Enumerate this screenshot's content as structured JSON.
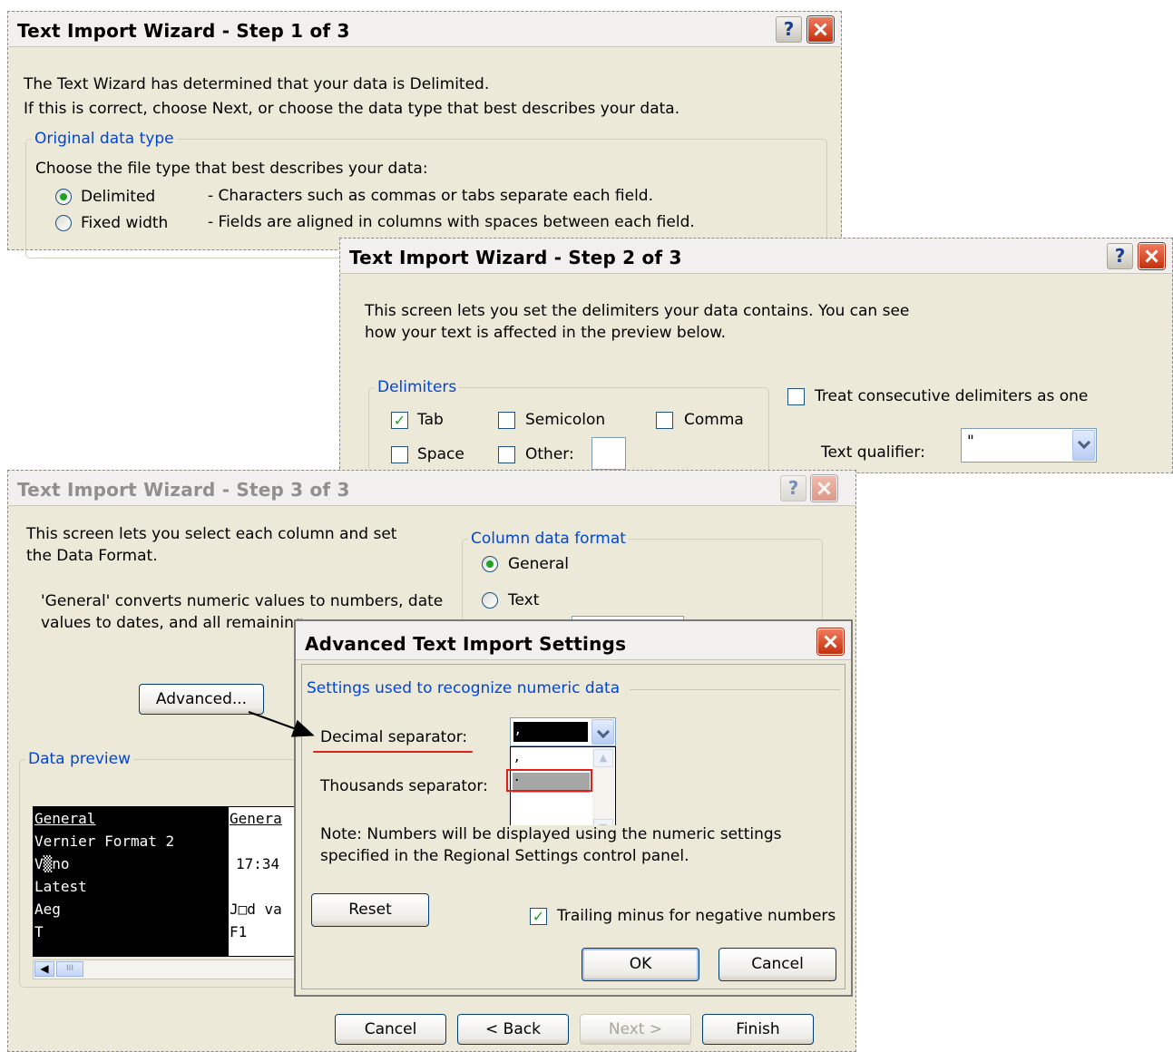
{
  "step1": {
    "title": "Text Import Wizard - Step 1 of 3",
    "help": "?",
    "line1": "The Text Wizard has determined that your data is Delimited.",
    "line2": "If this is correct, choose Next, or choose the data type that best describes your data.",
    "group_label": "Original data type",
    "choose_text": "Choose the file type that best describes your data:",
    "options": [
      {
        "label": "Delimited",
        "desc": "- Characters such as commas or tabs separate each field.",
        "selected": true
      },
      {
        "label": "Fixed width",
        "desc": "- Fields are aligned in columns with spaces between each field.",
        "selected": false
      }
    ]
  },
  "step2": {
    "title": "Text Import Wizard - Step 2 of 3",
    "help": "?",
    "intro1": "This screen lets you set the delimiters your data contains.  You can see",
    "intro2": "how your text is affected in the preview below.",
    "delimiters_label": "Delimiters",
    "tab": "Tab",
    "semicolon": "Semicolon",
    "comma": "Comma",
    "space": "Space",
    "other": "Other:",
    "consecutive": "Treat consecutive delimiters as one",
    "qualifier_label": "Text qualifier:",
    "qualifier_value": "\""
  },
  "step3": {
    "title": "Text Import Wizard - Step 3 of 3",
    "help": "?",
    "intro1": "This screen lets you select each column and set",
    "intro2": "the Data Format.",
    "general_note1": "'General' converts numeric values to numbers, date",
    "general_note2": "values to dates, and all remaining",
    "advanced_button": "Advanced...",
    "column_format_label": "Column data format",
    "general": "General",
    "text": "Text",
    "preview_label": "Data preview",
    "preview_col1": [
      "General",
      "Vernier Format 2",
      "V▒no",
      "Latest",
      "Aeg",
      "T"
    ],
    "preview_col2": [
      "Genera",
      "",
      "17:34",
      "",
      "J□d va",
      "F1"
    ],
    "scroll_thumb": "III",
    "buttons": {
      "cancel": "Cancel",
      "back": "< Back",
      "next": "Next >",
      "finish": "Finish"
    }
  },
  "advanced": {
    "title": "Advanced Text Import Settings",
    "group_label": "Settings used to recognize numeric data",
    "decimal_label": "Decimal separator:",
    "decimal_value": ",",
    "thousands_label": "Thousands separator:",
    "dropdown_options": [
      ",",
      "."
    ],
    "note1": "Note: Numbers will be displayed using the numeric settings",
    "note2": "specified in the Regional Settings control panel.",
    "reset": "Reset",
    "trailing_minus": "Trailing minus for negative numbers",
    "ok": "OK",
    "cancel": "Cancel"
  },
  "colors": {
    "annotation_red": "#e0201a",
    "link_blue": "#0046d5",
    "dialog_bg": "#ece9d8"
  }
}
